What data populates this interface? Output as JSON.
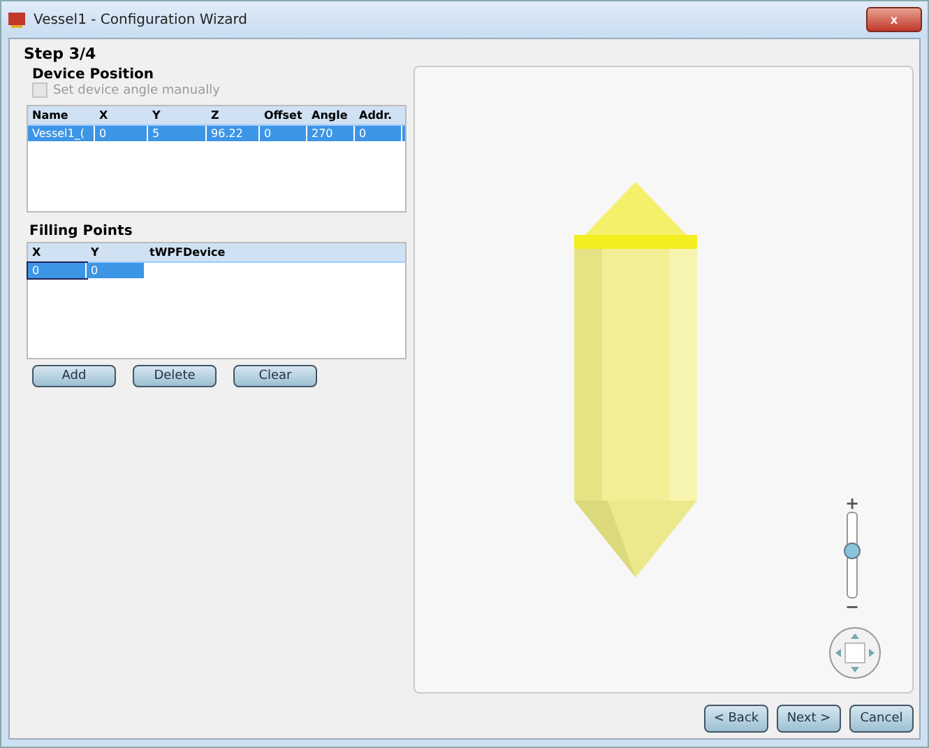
{
  "window": {
    "title": "Vessel1 - Configuration Wizard",
    "close": "x"
  },
  "step": "Step 3/4",
  "device_position": {
    "title": "Device Position",
    "checkbox": {
      "label": "Set device angle manually",
      "checked": false,
      "disabled": true
    },
    "table": {
      "columns": [
        "Name",
        "X",
        "Y",
        "Z",
        "Offset",
        "Angle",
        "Addr."
      ],
      "rows": [
        {
          "cells": [
            "Vessel1_(",
            "0",
            "5",
            "96.22",
            "0",
            "270",
            "0"
          ],
          "selected": true
        }
      ]
    }
  },
  "filling_points": {
    "title": "Filling Points",
    "table": {
      "columns": [
        "X",
        "Y",
        "tWPFDevice"
      ],
      "rows": [
        {
          "cells": [
            "0",
            "0",
            ""
          ],
          "selected": true
        }
      ]
    },
    "buttons": [
      "Add",
      "Delete",
      "Clear"
    ]
  },
  "viewer": {
    "zoom": {
      "plus": "+",
      "minus": "−",
      "level": 0.55
    }
  },
  "buttons": [
    "< Back",
    "Next >",
    "Cancel"
  ]
}
